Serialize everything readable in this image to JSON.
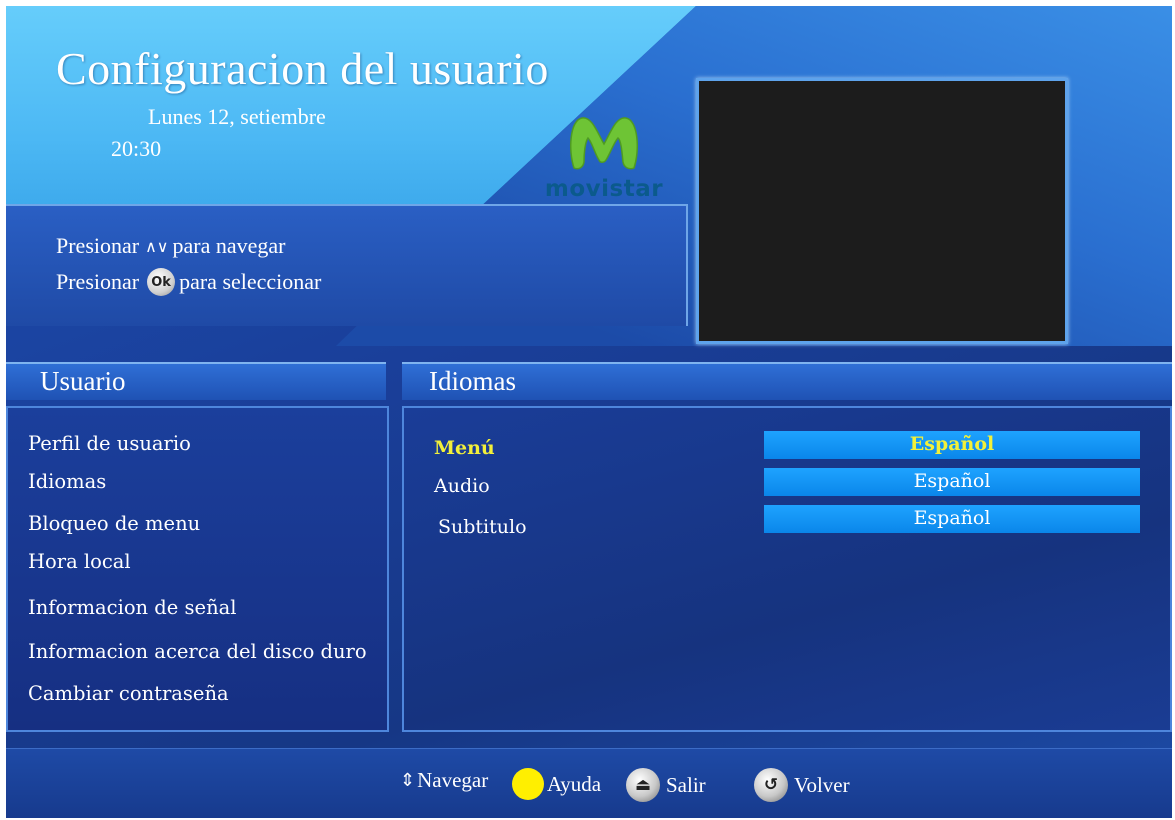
{
  "header": {
    "title": "Configuracion del usuario",
    "date": "Lunes 12, setiembre",
    "time": "20:30"
  },
  "brand": {
    "logo_text": "movistar",
    "logo_color": "#0b5a8c",
    "logo_icon": "movistar-m-icon"
  },
  "instructions": {
    "navigate_prefix": "Presionar",
    "navigate_arrows": "^v",
    "navigate_suffix": "para navegar",
    "select_prefix": "Presionar",
    "select_button": "Ok",
    "select_suffix": "para seleccionar"
  },
  "sidebar": {
    "title": "Usuario",
    "items": [
      {
        "label": "Perfil de usuario"
      },
      {
        "label": "Idiomas"
      },
      {
        "label": "Bloqueo de menu"
      },
      {
        "label": "Hora local"
      },
      {
        "label": "Informacion de señal"
      },
      {
        "label": "Informacion acerca del disco duro"
      },
      {
        "label": "Cambiar contraseña"
      }
    ]
  },
  "content": {
    "title": "Idiomas",
    "rows": [
      {
        "label": "Menú",
        "value": "Español",
        "active": true
      },
      {
        "label": "Audio",
        "value": "Español",
        "active": false
      },
      {
        "label": "Subtitulo",
        "value": "Español",
        "active": false
      }
    ]
  },
  "footer": {
    "navigate": "Navegar",
    "navigate_icon": "up-down-arrows-icon",
    "help": "Ayuda",
    "help_color": "#ffef00",
    "exit": "Salir",
    "exit_icon": "exit-icon",
    "back": "Volver",
    "back_icon": "back-icon"
  },
  "colors": {
    "highlight_text": "#f2f03a",
    "value_bar": "#0a86ea",
    "header_light_blue": "#4cb8f4",
    "panel_blue": "#16337f"
  }
}
